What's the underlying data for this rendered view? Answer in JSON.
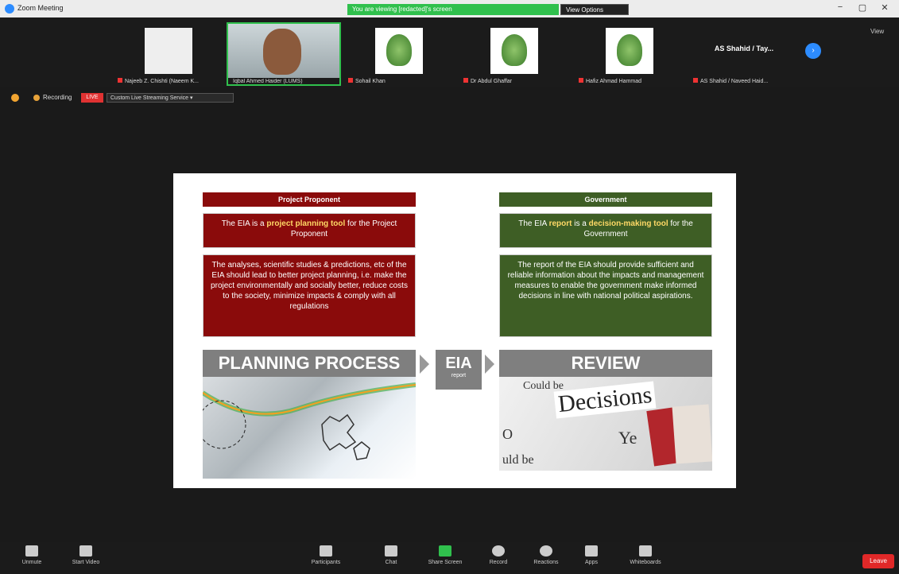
{
  "window": {
    "title": "Zoom Meeting",
    "share_banner": "You are viewing [redacted]'s screen",
    "view_options": "View Options",
    "controls": [
      "−",
      "▢",
      "✕"
    ]
  },
  "participants": [
    {
      "name": "Najeeb Z. Chishti (Naeem K...",
      "kind": "image"
    },
    {
      "name": "Iqbal Ahmed Haider (LUMS)",
      "kind": "video"
    },
    {
      "name": "Sohail Khan",
      "kind": "logo"
    },
    {
      "name": "Dr Abdul Ghaffar",
      "kind": "logo"
    },
    {
      "name": "Hafiz Ahmad Hammad",
      "kind": "logo"
    },
    {
      "name": "AS Shahid / Naveed Haid...",
      "kind": "logo"
    }
  ],
  "named_tile": {
    "big": "AS Shahid / Tay..."
  },
  "gallery_label": "View",
  "recording": {
    "label": "Recording",
    "live": "LIVE",
    "service": "Custom Live Streaming Service ▾"
  },
  "slide": {
    "left_header": "Project Proponent",
    "left_box1_pre": "The EIA is a ",
    "left_box1_bold": "project planning tool",
    "left_box1_post": " for the Project Proponent",
    "left_box2": "The analyses, scientific studies & predictions, etc of the EIA should lead to better project planning, i.e. make the project environmentally and socially better, reduce costs to the society, minimize impacts & comply with all regulations",
    "right_header": "Government",
    "right_box1_pre": "The EIA ",
    "right_box1_bold1": "report",
    "right_box1_mid": " is a ",
    "right_box1_bold2": "decision-making tool",
    "right_box1_post": " for the Government",
    "right_box2": "The report of the EIA should provide sufficient and reliable information about the impacts and management measures to enable the government make informed decisions in line with national political aspirations.",
    "planning_label": "PLANNING PROCESS",
    "eia_label": "EIA",
    "eia_sub": "report",
    "review_label": "REVIEW",
    "news_decisions": "Decisions",
    "news_word1": "Could be",
    "news_word2": "Ye",
    "news_word3": "uld be",
    "news_word4": "O"
  },
  "toolbar": [
    {
      "label": "Unmute",
      "icon": "microphone-icon"
    },
    {
      "label": "Start Video",
      "icon": "video-icon"
    },
    {
      "label": "Participants",
      "icon": "participants-icon"
    },
    {
      "label": "Chat",
      "icon": "chat-icon"
    },
    {
      "label": "Share Screen",
      "icon": "share-screen-icon"
    },
    {
      "label": "Record",
      "icon": "record-icon"
    },
    {
      "label": "Reactions",
      "icon": "reactions-icon"
    },
    {
      "label": "Apps",
      "icon": "apps-icon"
    },
    {
      "label": "Whiteboards",
      "icon": "whiteboard-icon"
    }
  ],
  "end_label": "Leave"
}
